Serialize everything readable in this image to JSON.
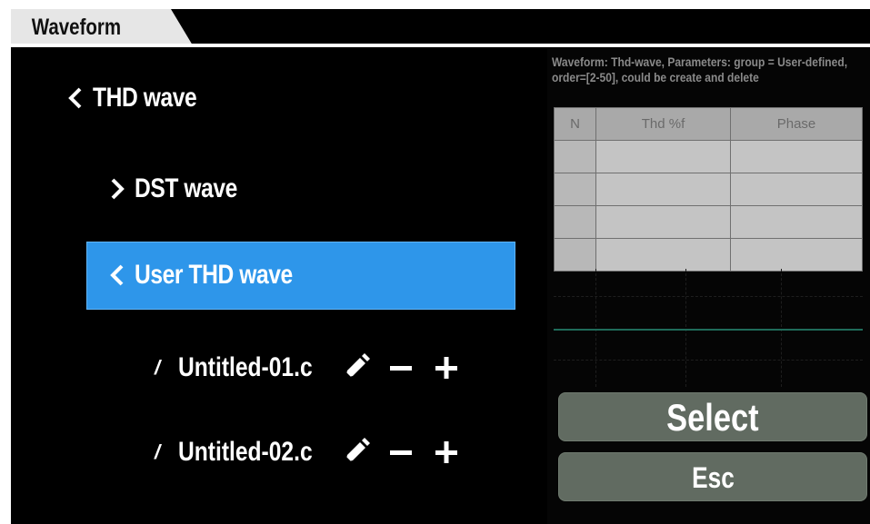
{
  "tab": {
    "title": "Waveform"
  },
  "menu": {
    "items": [
      {
        "label": "THD wave",
        "chevron": "chevron-left-icon"
      },
      {
        "label": "DST wave",
        "chevron": "chevron-right-icon"
      },
      {
        "label": "User THD wave",
        "chevron": "chevron-left-icon",
        "selected": true
      }
    ],
    "files": [
      {
        "bullet": "/",
        "name": "Untitled-01.c"
      },
      {
        "bullet": "/",
        "name": "Untitled-02.c"
      }
    ]
  },
  "description": "Waveform: Thd-wave, Parameters: group = User-defined, order=[2-50], could be create and delete",
  "table": {
    "headers": [
      "N",
      "Thd  %f",
      "Phase"
    ],
    "rows": 4
  },
  "buttons": {
    "select": "Select",
    "esc": "Esc"
  },
  "colors": {
    "selected": "#2e96ea",
    "button": "#616b61",
    "accent_line": "#1f6b5a"
  }
}
